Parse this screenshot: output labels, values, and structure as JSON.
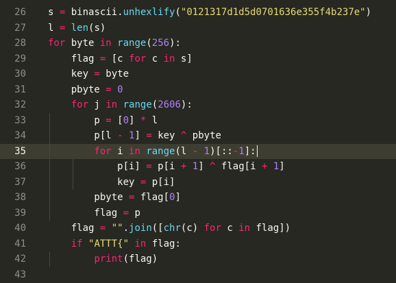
{
  "editor": {
    "theme": "monokai",
    "colors": {
      "background": "#272822",
      "current_line": "#3e3d32",
      "foreground": "#f8f8f2",
      "keyword": "#f92672",
      "builtin": "#66d9ef",
      "number": "#ae81ff",
      "string": "#e6db74",
      "line_number": "#90908a"
    },
    "current_line_number": "35",
    "lines": [
      {
        "n": "26",
        "tokens": [
          [
            "id",
            "s "
          ],
          [
            "op",
            "="
          ],
          [
            "id",
            " binascii."
          ],
          [
            "fn",
            "unhexlify"
          ],
          [
            "id",
            "("
          ],
          [
            "str",
            "\"0121317d1d5d0701636e355f4b237e\""
          ],
          [
            "id",
            ")"
          ]
        ]
      },
      {
        "n": "27",
        "tokens": [
          [
            "id",
            "l "
          ],
          [
            "op",
            "="
          ],
          [
            "id",
            " "
          ],
          [
            "fn",
            "len"
          ],
          [
            "id",
            "(s)"
          ]
        ]
      },
      {
        "n": "28",
        "tokens": [
          [
            "kw",
            "for"
          ],
          [
            "id",
            " byte "
          ],
          [
            "kw",
            "in"
          ],
          [
            "id",
            " "
          ],
          [
            "fn",
            "range"
          ],
          [
            "id",
            "("
          ],
          [
            "num",
            "256"
          ],
          [
            "id",
            "):"
          ]
        ]
      },
      {
        "n": "29",
        "tokens": [
          [
            "id",
            "    flag "
          ],
          [
            "op",
            "="
          ],
          [
            "id",
            " [c "
          ],
          [
            "kw",
            "for"
          ],
          [
            "id",
            " c "
          ],
          [
            "kw",
            "in"
          ],
          [
            "id",
            " s]"
          ]
        ]
      },
      {
        "n": "30",
        "tokens": [
          [
            "id",
            "    key "
          ],
          [
            "op",
            "="
          ],
          [
            "id",
            " byte"
          ]
        ]
      },
      {
        "n": "31",
        "tokens": [
          [
            "id",
            "    pbyte "
          ],
          [
            "op",
            "="
          ],
          [
            "id",
            " "
          ],
          [
            "num",
            "0"
          ]
        ]
      },
      {
        "n": "32",
        "tokens": [
          [
            "id",
            "    "
          ],
          [
            "kw",
            "for"
          ],
          [
            "id",
            " j "
          ],
          [
            "kw",
            "in"
          ],
          [
            "id",
            " "
          ],
          [
            "fn",
            "range"
          ],
          [
            "id",
            "("
          ],
          [
            "num",
            "2606"
          ],
          [
            "id",
            "):"
          ]
        ]
      },
      {
        "n": "33",
        "tokens": [
          [
            "id",
            "        p "
          ],
          [
            "op",
            "="
          ],
          [
            "id",
            " ["
          ],
          [
            "num",
            "0"
          ],
          [
            "id",
            "] "
          ],
          [
            "op",
            "*"
          ],
          [
            "id",
            " l"
          ]
        ]
      },
      {
        "n": "34",
        "tokens": [
          [
            "id",
            "        p[l "
          ],
          [
            "op",
            "-"
          ],
          [
            "id",
            " "
          ],
          [
            "num",
            "1"
          ],
          [
            "id",
            "] "
          ],
          [
            "op",
            "="
          ],
          [
            "id",
            " key "
          ],
          [
            "op",
            "^"
          ],
          [
            "id",
            " pbyte"
          ]
        ]
      },
      {
        "n": "35",
        "tokens": [
          [
            "id",
            "        "
          ],
          [
            "kw",
            "for"
          ],
          [
            "id",
            " i "
          ],
          [
            "kw",
            "in"
          ],
          [
            "id",
            " "
          ],
          [
            "fn",
            "range"
          ],
          [
            "id",
            "(l "
          ],
          [
            "op",
            "-"
          ],
          [
            "id",
            " "
          ],
          [
            "num",
            "1"
          ],
          [
            "id",
            ")[::"
          ],
          [
            "op",
            "-"
          ],
          [
            "num",
            "1"
          ],
          [
            "id",
            "]:"
          ]
        ]
      },
      {
        "n": "36",
        "tokens": [
          [
            "id",
            "            p[i] "
          ],
          [
            "op",
            "="
          ],
          [
            "id",
            " p[i "
          ],
          [
            "op",
            "+"
          ],
          [
            "id",
            " "
          ],
          [
            "num",
            "1"
          ],
          [
            "id",
            "] "
          ],
          [
            "op",
            "^"
          ],
          [
            "id",
            " flag[i "
          ],
          [
            "op",
            "+"
          ],
          [
            "id",
            " "
          ],
          [
            "num",
            "1"
          ],
          [
            "id",
            "]"
          ]
        ]
      },
      {
        "n": "37",
        "tokens": [
          [
            "id",
            "            key "
          ],
          [
            "op",
            "="
          ],
          [
            "id",
            " p[i]"
          ]
        ]
      },
      {
        "n": "38",
        "tokens": [
          [
            "id",
            "        pbyte "
          ],
          [
            "op",
            "="
          ],
          [
            "id",
            " flag["
          ],
          [
            "num",
            "0"
          ],
          [
            "id",
            "]"
          ]
        ]
      },
      {
        "n": "39",
        "tokens": [
          [
            "id",
            "        flag "
          ],
          [
            "op",
            "="
          ],
          [
            "id",
            " p"
          ]
        ]
      },
      {
        "n": "40",
        "tokens": [
          [
            "id",
            "    flag "
          ],
          [
            "op",
            "="
          ],
          [
            "id",
            " "
          ],
          [
            "str",
            "\"\""
          ],
          [
            "id",
            "."
          ],
          [
            "fn",
            "join"
          ],
          [
            "id",
            "(["
          ],
          [
            "fn",
            "chr"
          ],
          [
            "id",
            "(c) "
          ],
          [
            "kw",
            "for"
          ],
          [
            "id",
            " c "
          ],
          [
            "kw",
            "in"
          ],
          [
            "id",
            " flag])"
          ]
        ]
      },
      {
        "n": "41",
        "tokens": [
          [
            "id",
            "    "
          ],
          [
            "kw",
            "if"
          ],
          [
            "id",
            " "
          ],
          [
            "str",
            "\"ATTT{\""
          ],
          [
            "id",
            " "
          ],
          [
            "kw",
            "in"
          ],
          [
            "id",
            " flag:"
          ]
        ]
      },
      {
        "n": "42",
        "tokens": [
          [
            "id",
            "        "
          ],
          [
            "kw",
            "print"
          ],
          [
            "id",
            "(flag)"
          ]
        ]
      },
      {
        "n": "43",
        "tokens": []
      }
    ]
  }
}
